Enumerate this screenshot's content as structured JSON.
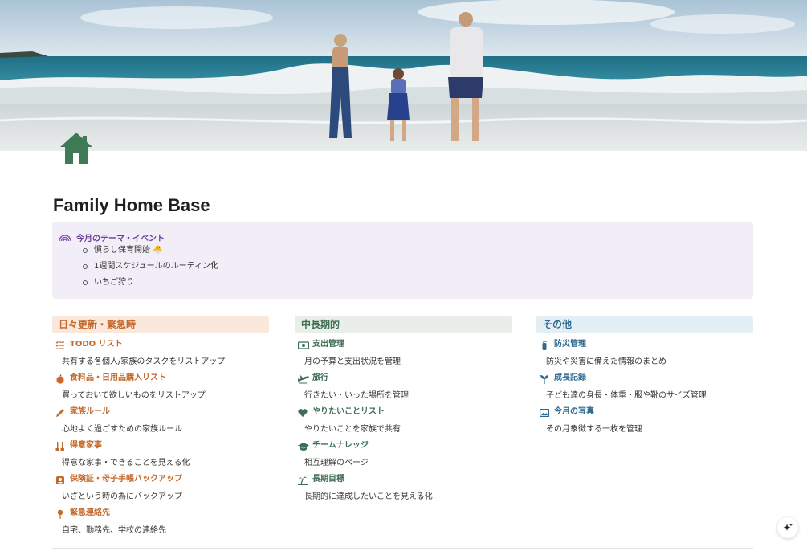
{
  "page": {
    "title": "Family Home Base",
    "icon": "house-icon"
  },
  "callout": {
    "icon": "rainbow-icon",
    "title": "今月のテーマ・イベント",
    "items": [
      "慣らし保育開始 🐣",
      "1週間スケジュールのルーティン化",
      "いちご狩り"
    ]
  },
  "columns": [
    {
      "heading": "日々更新・緊急時",
      "color": "#c4692b",
      "background": "#fbe8dc",
      "items": [
        {
          "title": "TODO リスト",
          "icon": "checklist-icon",
          "description": "共有する各個人/家族のタスクをリストアップ"
        },
        {
          "title": "食料品・日用品購入リスト",
          "icon": "apple-icon",
          "description": "買っておいて欲しいものをリストアップ"
        },
        {
          "title": "家族ルール",
          "icon": "pencil-icon",
          "description": "心地よく過ごすための家族ルール"
        },
        {
          "title": "得意家事",
          "icon": "broom-icon",
          "description": "得意な家事・できることを見える化"
        },
        {
          "title": "保険証・母子手帳バックアップ",
          "icon": "id-badge-icon",
          "description": "いざという時の為にバックアップ"
        },
        {
          "title": "緊急連絡先",
          "icon": "pin-icon",
          "description": "自宅、勤務先、学校の連絡先"
        }
      ]
    },
    {
      "heading": "中長期的",
      "color": "#3f6e53",
      "background": "#e9efe8",
      "items": [
        {
          "title": "支出管理",
          "icon": "money-icon",
          "description": "月の予算と支出状況を管理"
        },
        {
          "title": "旅行",
          "icon": "airplane-icon",
          "description": "行きたい・いった場所を管理"
        },
        {
          "title": "やりたいことリスト",
          "icon": "heart-icon",
          "description": "やりたいことを家族で共有"
        },
        {
          "title": "チームナレッジ",
          "icon": "graduation-cap-icon",
          "description": "相互理解のページ"
        },
        {
          "title": "長期目標",
          "icon": "island-icon",
          "description": "長期的に達成したいことを見える化"
        }
      ]
    },
    {
      "heading": "その他",
      "color": "#2f6b90",
      "background": "#e3eef5",
      "items": [
        {
          "title": "防災管理",
          "icon": "extinguisher-icon",
          "description": "防災や災害に備えた情報のまとめ"
        },
        {
          "title": "成長記録",
          "icon": "sprout-icon",
          "description": "子ども達の身長・体重・服や靴のサイズ管理"
        },
        {
          "title": "今月の写真",
          "icon": "photo-icon",
          "description": "その月象徴する一枚を管理"
        }
      ]
    }
  ],
  "ai_button": {
    "icon": "sparkle-icon"
  }
}
